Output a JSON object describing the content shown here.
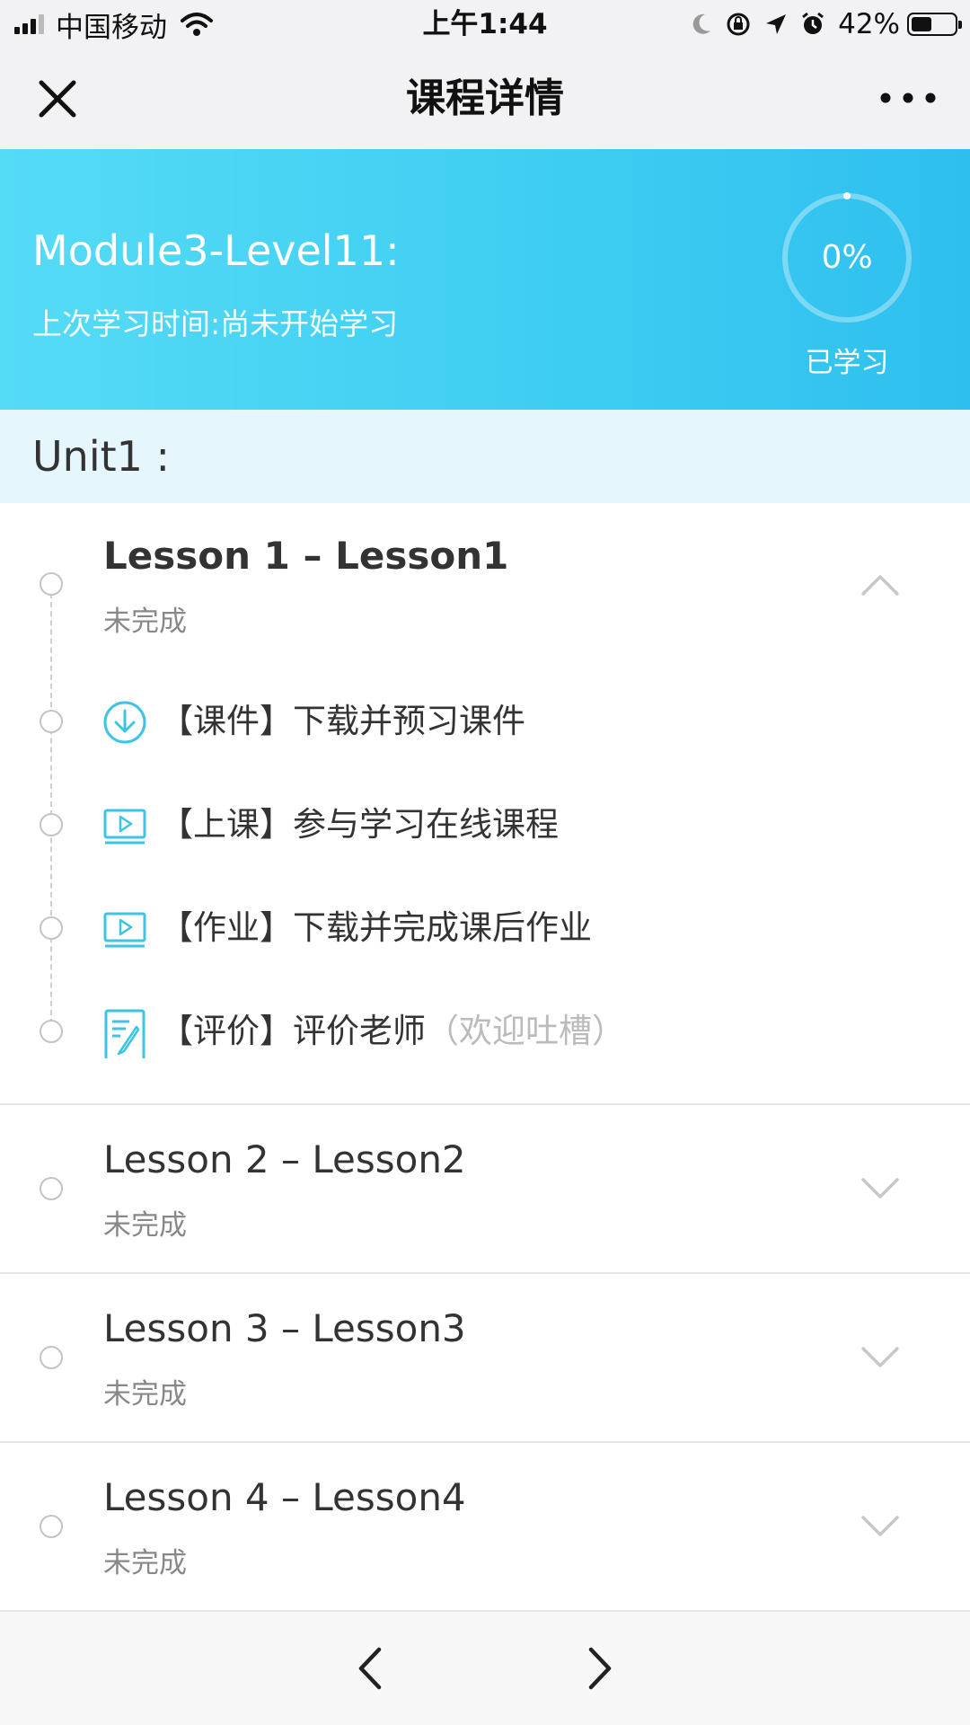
{
  "status_bar": {
    "carrier": "中国移动",
    "time": "上午1:44",
    "battery": "42%",
    "battery_level": 0.42
  },
  "nav": {
    "title": "课程详情",
    "close_icon": "close-icon",
    "more_icon": "more-icon"
  },
  "hero": {
    "title": "Module3-Level11:",
    "last_study": "上次学习时间:尚未开始学习",
    "progress": "0%",
    "progress_value": 0,
    "progress_caption": "已学习"
  },
  "unit": {
    "title": "Unit1 :"
  },
  "lessons": [
    {
      "title": "Lesson 1 – Lesson1",
      "status": "未完成",
      "expanded": true,
      "tasks": [
        {
          "icon": "download-icon",
          "text": "【课件】下载并预习课件",
          "note": ""
        },
        {
          "icon": "video-icon",
          "text": "【上课】参与学习在线课程",
          "note": ""
        },
        {
          "icon": "video-icon",
          "text": "【作业】下载并完成课后作业",
          "note": ""
        },
        {
          "icon": "edit-note-icon",
          "text": "【评价】评价老师",
          "note": "（欢迎吐槽）"
        }
      ]
    },
    {
      "title": "Lesson 2 – Lesson2",
      "status": "未完成",
      "expanded": false
    },
    {
      "title": "Lesson 3 – Lesson3",
      "status": "未完成",
      "expanded": false
    },
    {
      "title": "Lesson 4 – Lesson4",
      "status": "未完成",
      "expanded": false
    }
  ],
  "colors": {
    "accent": "#3fcef2",
    "unit_bg": "#e5f6fd",
    "icon": "#3cc4e4"
  }
}
